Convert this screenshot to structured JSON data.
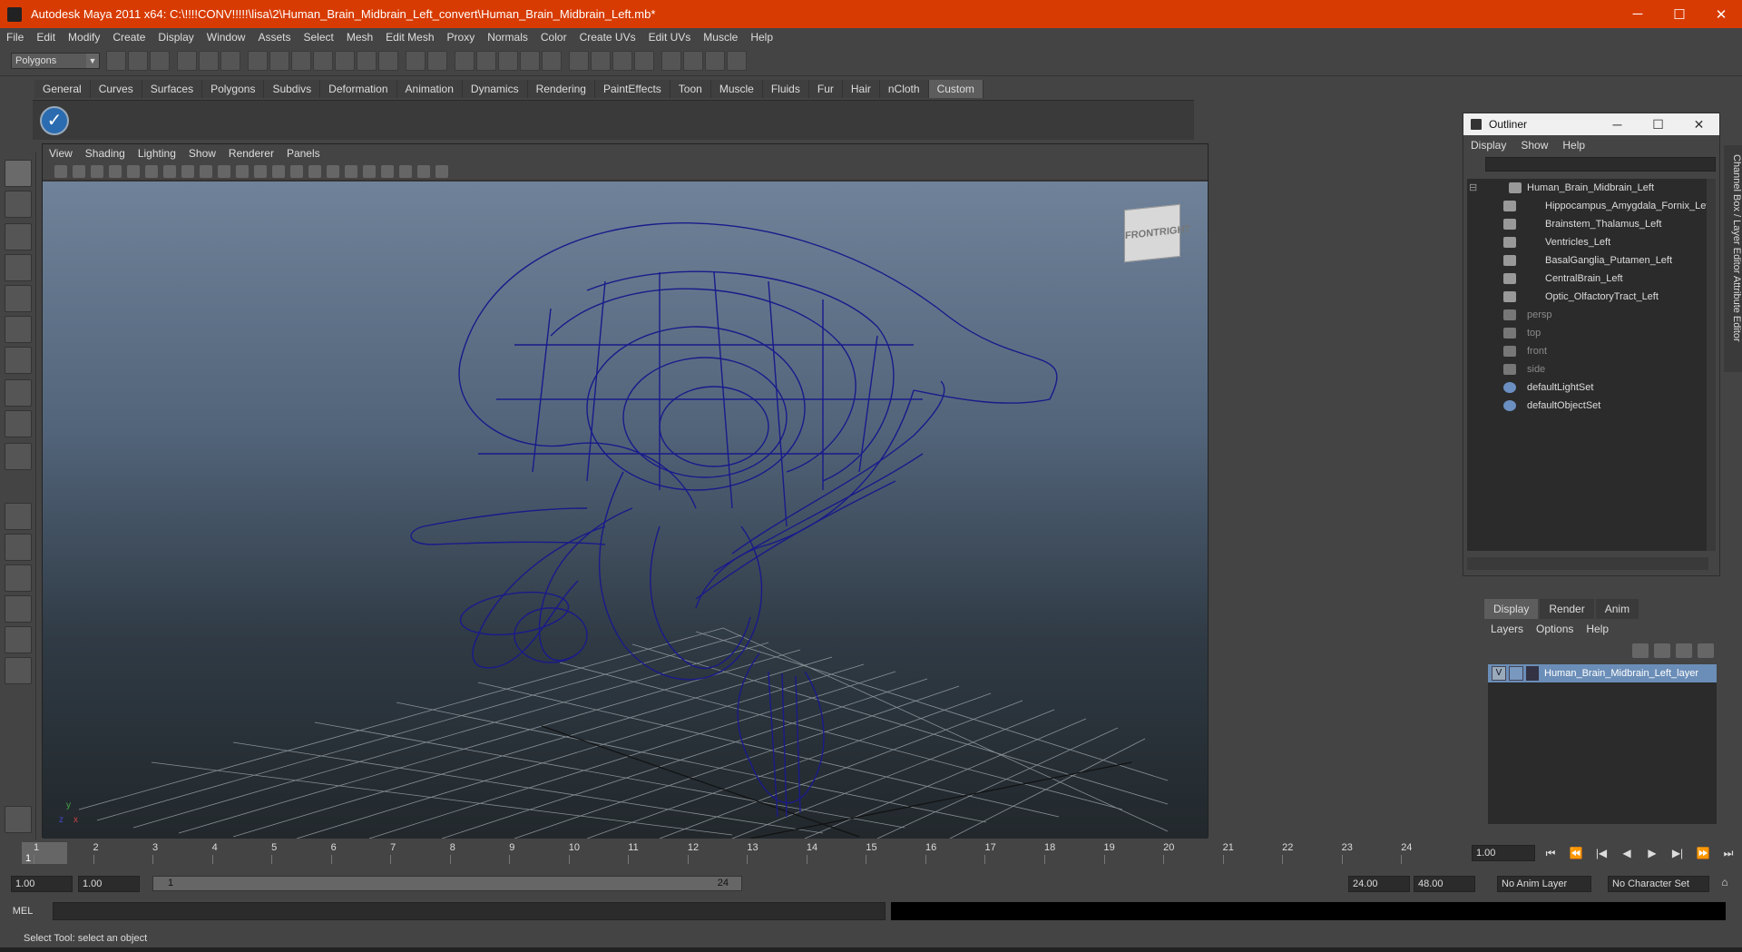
{
  "window": {
    "title": "Autodesk Maya 2011 x64: C:\\!!!!CONV!!!!!\\lisa\\2\\Human_Brain_Midbrain_Left_convert\\Human_Brain_Midbrain_Left.mb*",
    "minimize": "─",
    "maximize": "☐",
    "close": "✕"
  },
  "menu": [
    "File",
    "Edit",
    "Modify",
    "Create",
    "Display",
    "Window",
    "Assets",
    "Select",
    "Mesh",
    "Edit Mesh",
    "Proxy",
    "Normals",
    "Color",
    "Create UVs",
    "Edit UVs",
    "Muscle",
    "Help"
  ],
  "toolbar": {
    "mode": "Polygons",
    "mode_arrow": "▼"
  },
  "shelf_tabs": [
    "General",
    "Curves",
    "Surfaces",
    "Polygons",
    "Subdivs",
    "Deformation",
    "Animation",
    "Dynamics",
    "Rendering",
    "PaintEffects",
    "Toon",
    "Muscle",
    "Fluids",
    "Fur",
    "Hair",
    "nCloth",
    "Custom"
  ],
  "shelf": {
    "check": "✓"
  },
  "viewport": {
    "menu": [
      "View",
      "Shading",
      "Lighting",
      "Show",
      "Renderer",
      "Panels"
    ],
    "viewcube": {
      "front": "FRONT",
      "right": "RIGHT"
    },
    "axis": {
      "x": "x",
      "y": "y",
      "z": "z"
    }
  },
  "outliner": {
    "title": "Outliner",
    "menu": [
      "Display",
      "Show",
      "Help"
    ],
    "collapse": "⊟",
    "rows": [
      {
        "label": "Human_Brain_Midbrain_Left",
        "dim": false,
        "level": 0
      },
      {
        "label": "Hippocampus_Amygdala_Fornix_Left",
        "dim": false,
        "level": 1
      },
      {
        "label": "Brainstem_Thalamus_Left",
        "dim": false,
        "level": 1
      },
      {
        "label": "Ventricles_Left",
        "dim": false,
        "level": 1
      },
      {
        "label": "BasalGanglia_Putamen_Left",
        "dim": false,
        "level": 1
      },
      {
        "label": "CentralBrain_Left",
        "dim": false,
        "level": 1
      },
      {
        "label": "Optic_OlfactoryTract_Left",
        "dim": false,
        "level": 1
      },
      {
        "label": "persp",
        "dim": true,
        "level": 0
      },
      {
        "label": "top",
        "dim": true,
        "level": 0
      },
      {
        "label": "front",
        "dim": true,
        "level": 0
      },
      {
        "label": "side",
        "dim": true,
        "level": 0
      },
      {
        "label": "defaultLightSet",
        "dim": false,
        "level": 0
      },
      {
        "label": "defaultObjectSet",
        "dim": false,
        "level": 0
      }
    ]
  },
  "layers": {
    "tabs": [
      "Display",
      "Render",
      "Anim"
    ],
    "menu": [
      "Layers",
      "Options",
      "Help"
    ],
    "row": {
      "visible": "V",
      "name": "Human_Brain_Midbrain_Left_layer"
    }
  },
  "side_tabs": "Channel Box / Layer Editor     Attribute Editor",
  "timeline": {
    "ticks": [
      "1",
      "2",
      "3",
      "4",
      "5",
      "6",
      "7",
      "8",
      "9",
      "10",
      "11",
      "12",
      "13",
      "14",
      "15",
      "16",
      "17",
      "18",
      "19",
      "20",
      "21",
      "22",
      "23",
      "24"
    ],
    "current_label": "1",
    "current_frame": "1.00",
    "play": [
      "⏮",
      "⏪",
      "|◀",
      "◀",
      "▶",
      "▶|",
      "⏩",
      "⏭"
    ]
  },
  "range": {
    "start": "1.00",
    "playback_start": "1.00",
    "slider_start": "1",
    "slider_end": "24",
    "playback_end": "24.00",
    "end": "48.00",
    "anim_layer": "No Anim Layer",
    "character_set": "No Character Set"
  },
  "command": {
    "label": "MEL"
  },
  "help_line": "Select Tool: select an object"
}
